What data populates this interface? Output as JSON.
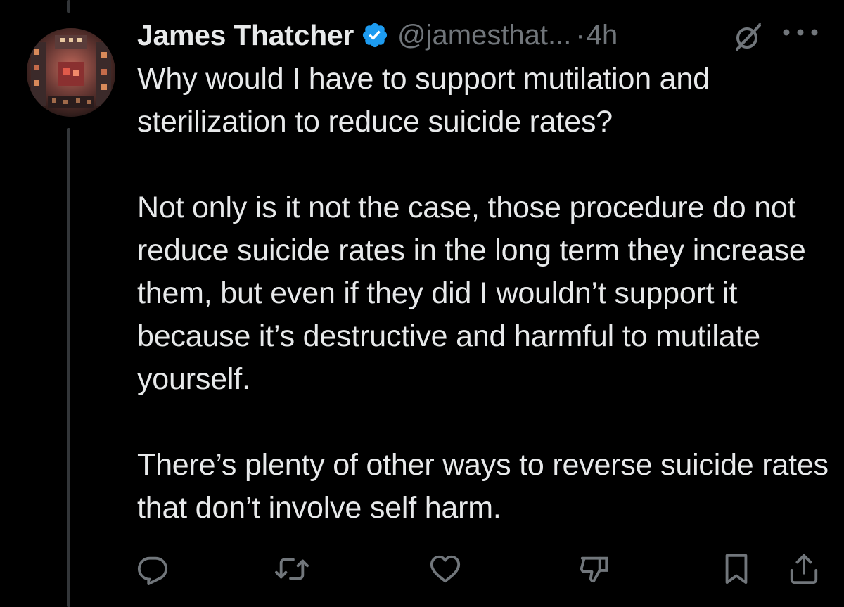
{
  "tweet": {
    "author": {
      "display_name": "James Thatcher",
      "verified": true,
      "handle": "@jamesthat...",
      "avatar": "avatar-image"
    },
    "separator": "·",
    "time": "4h",
    "paragraphs": [
      "Why would I have to support mutilation and sterilization to reduce suicide rates?",
      "Not only is it not the case, those procedure do not reduce suicide rates in the long term they increase them, but even if they did I wouldn’t support it because it’s destructive and harmful to mutilate yourself.",
      "There’s plenty of other ways to reverse suicide rates that don’t involve self harm."
    ]
  },
  "icons": {
    "verified": "verified-badge-icon",
    "grok": "grok-icon",
    "more": "more-icon",
    "reply": "reply-icon",
    "retweet": "retweet-icon",
    "like": "heart-icon",
    "downvote": "downvote-icon",
    "bookmark": "bookmark-icon",
    "share": "share-icon"
  },
  "colors": {
    "background": "#000000",
    "text": "#e7e9ea",
    "secondary": "#71767b",
    "verified": "#1d9bf0",
    "thread_line": "#333639"
  }
}
